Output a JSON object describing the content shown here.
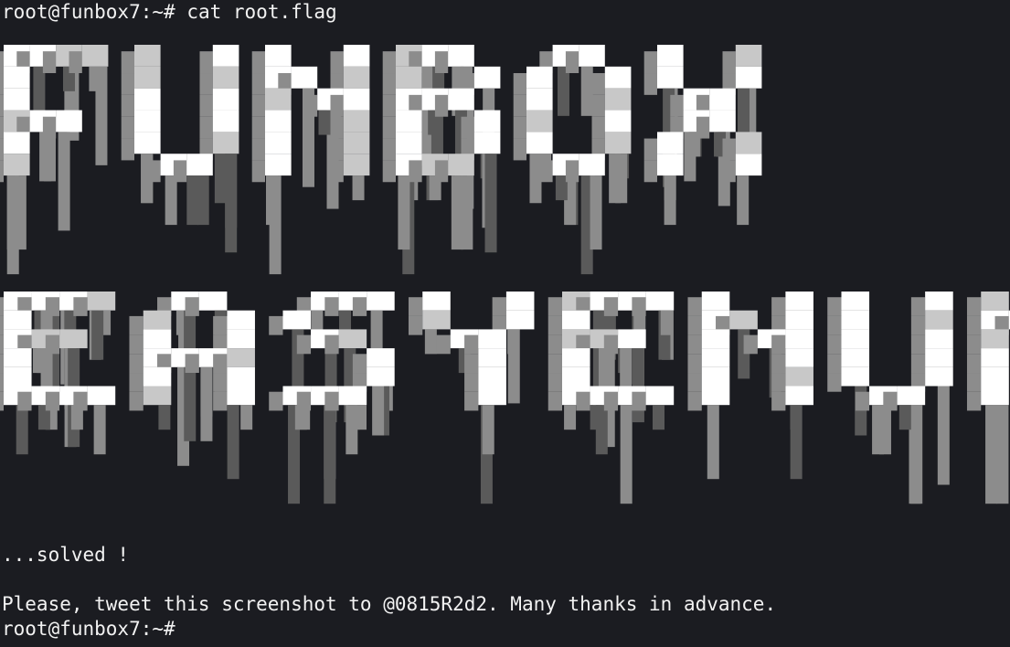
{
  "terminal": {
    "prompt": "root@funbox7:~#",
    "command": "cat root.flag",
    "banner_words": [
      "FUNBOX",
      "EASYENUM"
    ],
    "solved_text": "...solved !",
    "message": "Please, tweet this screenshot to @0815R2d2. Many thanks in advance."
  },
  "colors": {
    "background": "#1b1c21",
    "text": "#f2f2f2",
    "banner_shades": [
      "#ffffff",
      "#c8c8c8",
      "#8c8c8c",
      "#5a5a5a"
    ]
  }
}
